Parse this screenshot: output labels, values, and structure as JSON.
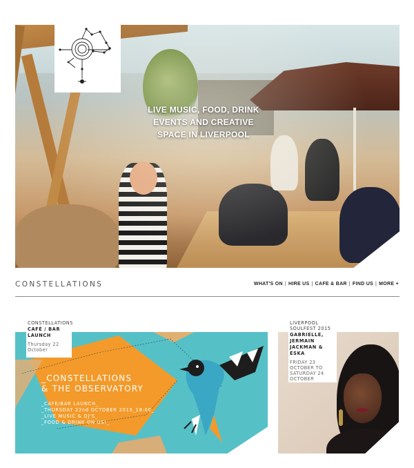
{
  "hero": {
    "headline": "LIVE MUSIC, FOOD, DRINK EVENTS AND CREATIVE SPACE IN LIVERPOOL"
  },
  "brand": {
    "name": "CONSTELLATIONS"
  },
  "nav": {
    "items": [
      "WHAT'S ON",
      "HIRE US",
      "CAFE & BAR",
      "FIND US",
      "MORE +"
    ],
    "separator": "|"
  },
  "cards": [
    {
      "kicker": "CONSTELLATIONS",
      "title": "CAFÉ / BAR LAUNCH",
      "date": "Thursday 22 October",
      "poster": {
        "title_line1": "_CONSTELLATIONS",
        "title_line2": "& THE OBSERVATORY",
        "lines": [
          "_CAFE/BAR LAUNCH_",
          "_THURSDAY 22nd OCTOBER 2015_18:00_",
          "_LIVE MUSIC & DJ'S_",
          "_FOOD & DRINK ON US!_"
        ]
      }
    },
    {
      "kicker": "LIVERPOOL SOULFEST 2015",
      "title": "GABRIELLE, JERMAIN JACKMAN & ESKA",
      "date": "FRIDAY 23 OCTOBER TO SATURDAY 24 OCTOBER"
    }
  ],
  "colors": {
    "poster_teal": "#56c0c7",
    "poster_orange": "#f39a2a",
    "rule": "#888888"
  }
}
